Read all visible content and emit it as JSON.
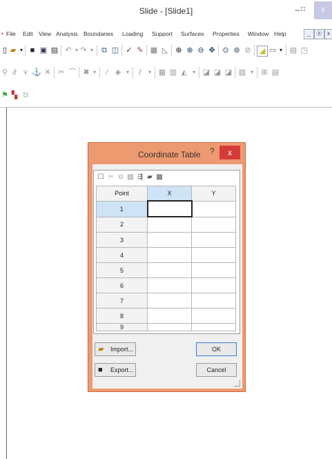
{
  "window": {
    "title": "Slide - [Slide1]",
    "minimize_glyph": "–",
    "maximize_glyph": "□",
    "close_glyph": "x"
  },
  "menu": {
    "items": [
      "File",
      "Edit",
      "View",
      "Analysis",
      "Boundaries",
      "Loading",
      "Support",
      "Surfaces",
      "Properties",
      "Window",
      "Help"
    ],
    "mdi_min": "_",
    "mdi_restore": "ⓑ",
    "mdi_close": "x"
  },
  "toolbar1": [
    "new-file-icon",
    "dropdown-arrow-icon",
    "save-icon",
    "print-preview-icon",
    "print-icon",
    "undo-icon",
    "redo-icon",
    "copy-icon",
    "paste-special-icon",
    "select-icon",
    "paint-icon",
    "display-icon",
    "graph-icon",
    "zoom-all-icon",
    "zoom-in-icon",
    "zoom-out-icon",
    "pan-icon",
    "zoom-window-icon",
    "zoom-previous-icon",
    "zoom-extents-icon",
    "layer-icon",
    "dropdown-arrow-icon",
    "layout-icon"
  ],
  "toolbar2": [
    "snap-icon",
    "vertex-icon",
    "pin-icon",
    "cross-icon",
    "cut-icon",
    "arc-icon",
    "multi-select-icon",
    "line-icon",
    "diamond-icon",
    "angle-icon",
    "grid-icon",
    "grid-alt-icon",
    "chart-icon",
    "fill-a-icon",
    "fill-b-icon",
    "fill-c-icon",
    "report-icon",
    "tiles-icon",
    "table-icon"
  ],
  "toolbar3": [
    "flag-icon",
    "bookmark-icon",
    "copy-disabled-icon"
  ],
  "dialog": {
    "title": "Coordinate Table",
    "help_glyph": "?",
    "close_glyph": "x",
    "columns": [
      "Point",
      "X",
      "Y"
    ],
    "rows": [
      "1",
      "2",
      "3",
      "4",
      "5",
      "6",
      "7",
      "8",
      "9"
    ],
    "import_label": "Import...",
    "export_label": "Export...",
    "ok_label": "OK",
    "cancel_label": "Cancel"
  },
  "colors": {
    "dialog_frame": "#ee9a70",
    "close_button": "#d53a3a",
    "selection": "#cfe3f7"
  }
}
